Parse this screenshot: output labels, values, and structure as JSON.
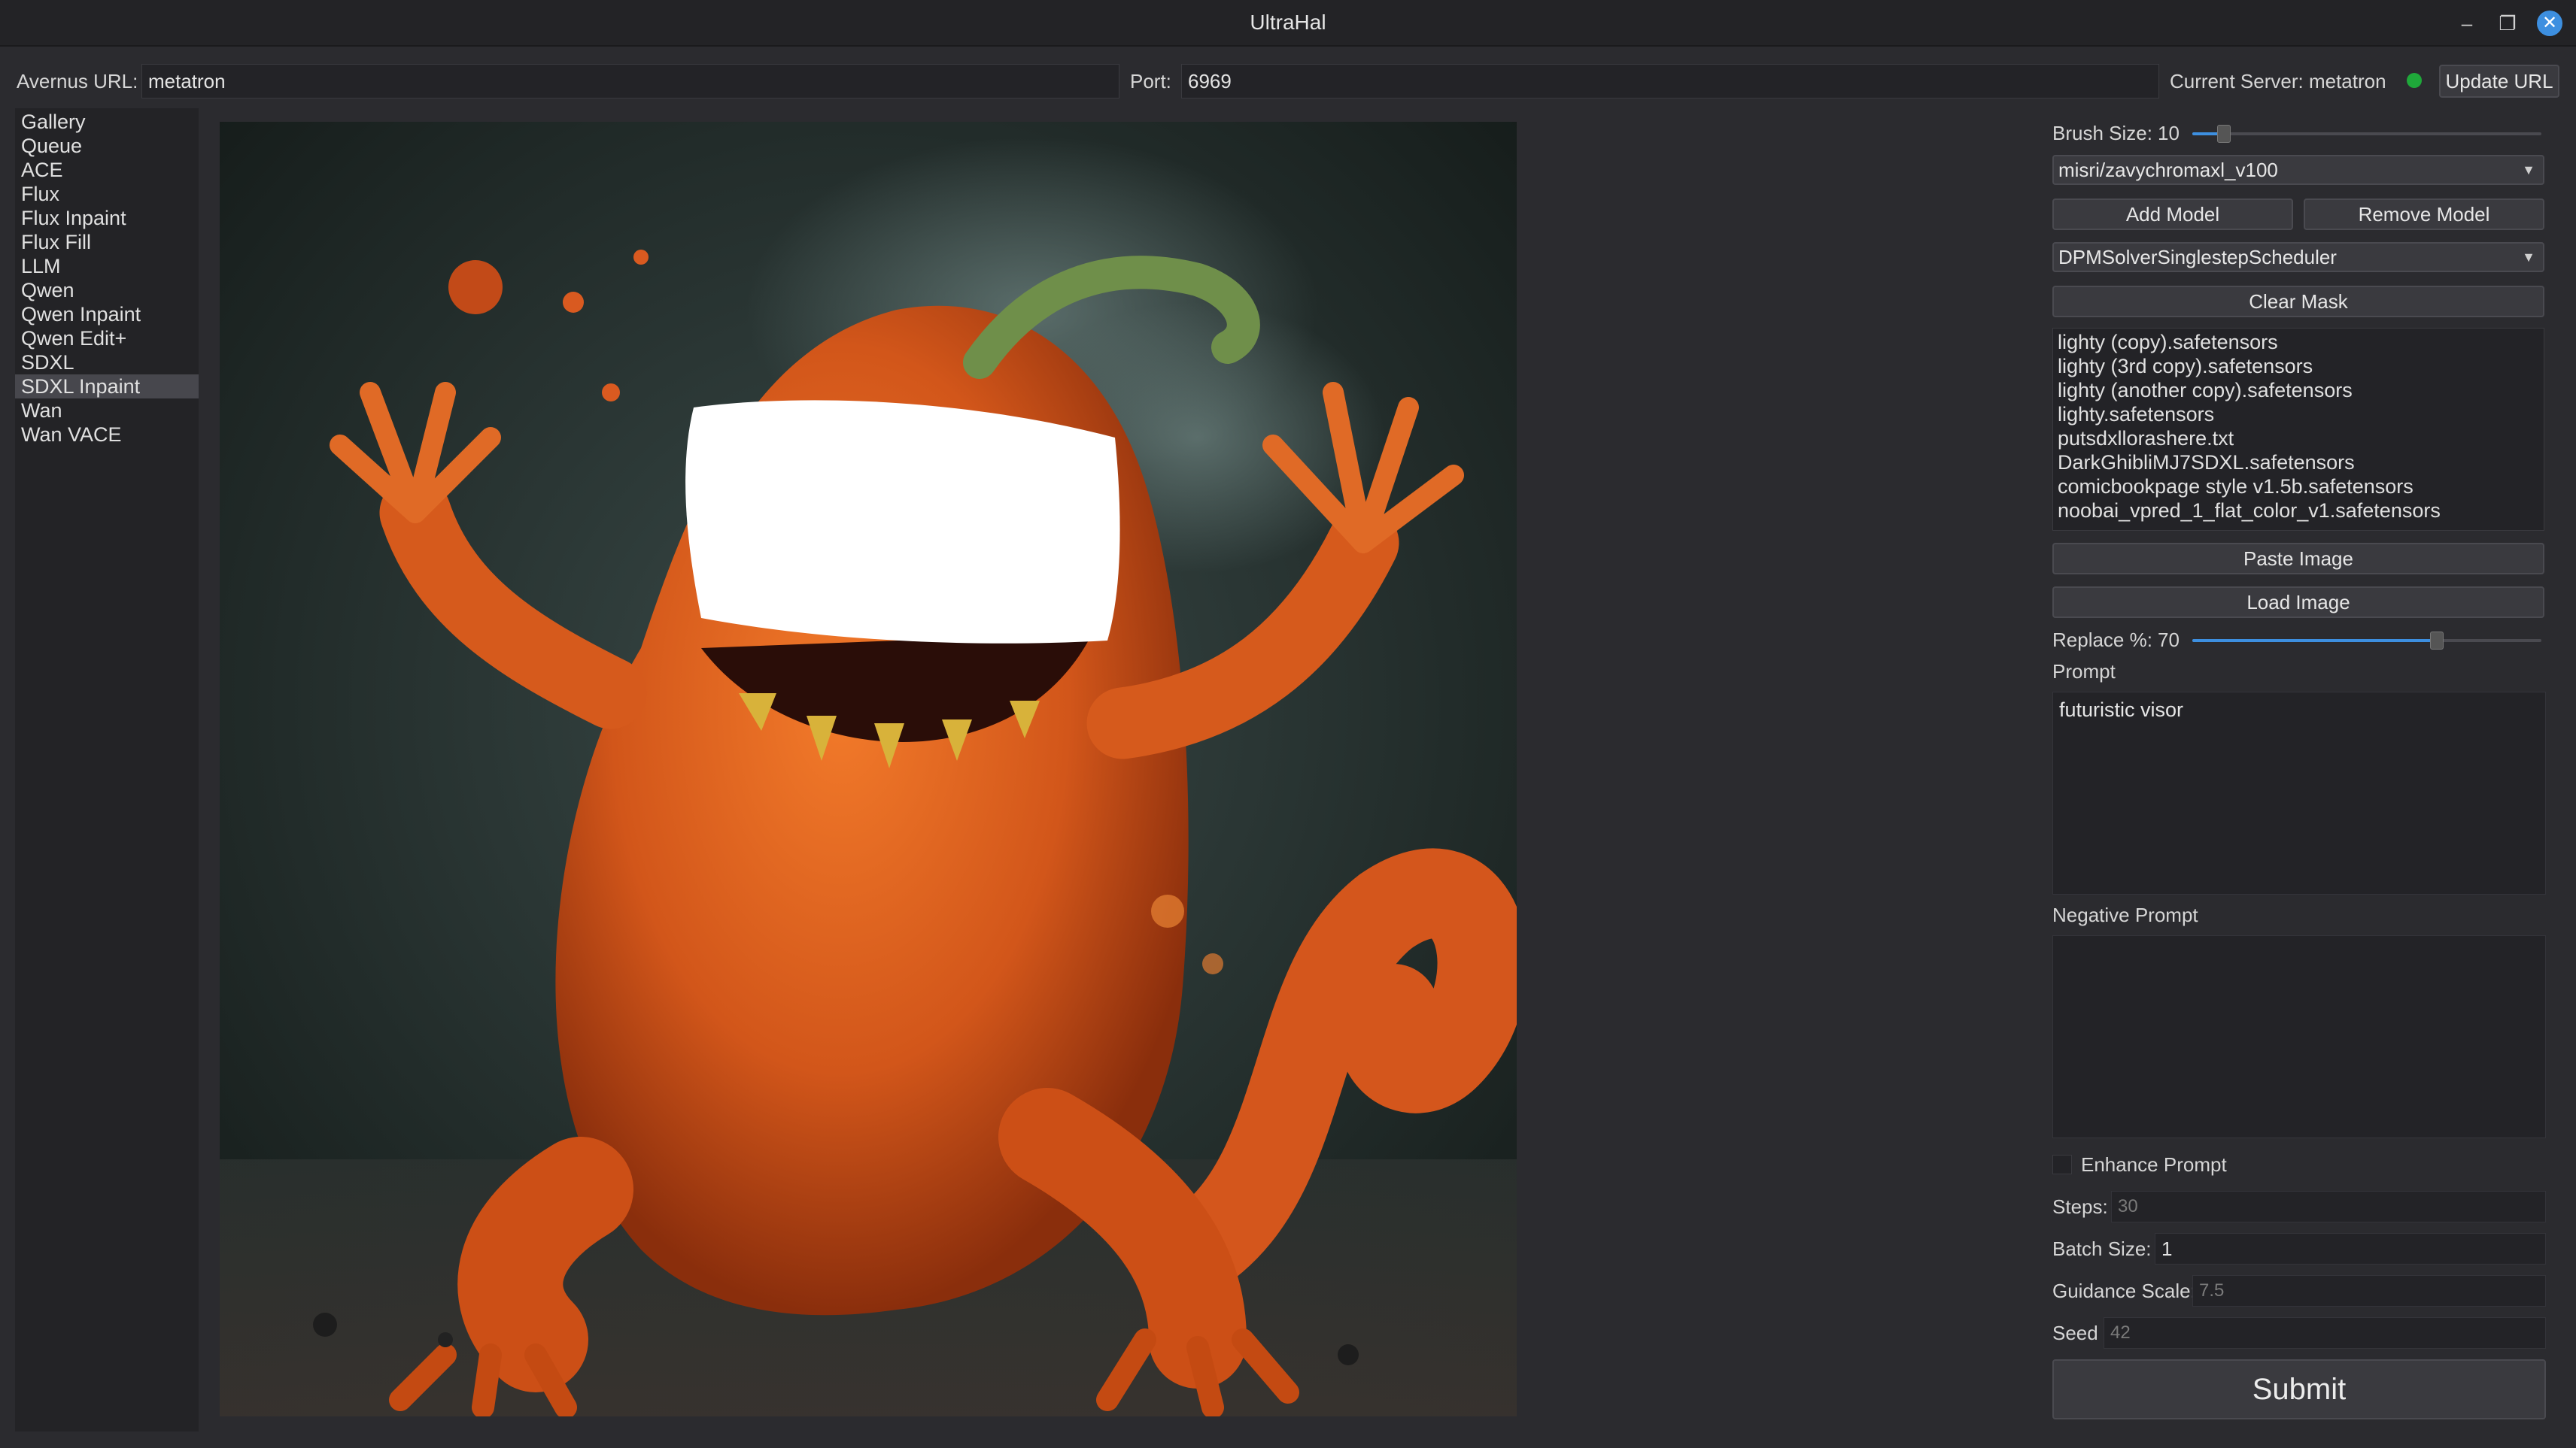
{
  "window": {
    "title": "UltraHal",
    "minimize_glyph": "–",
    "maximize_glyph": "❐",
    "close_glyph": "✕"
  },
  "urlbar": {
    "avernus_label": "Avernus URL:",
    "avernus_value": "metatron",
    "port_label": "Port:",
    "port_value": "6969",
    "current_server": "Current Server: metatron",
    "server_status_color": "#1fa83a",
    "update_button": "Update URL"
  },
  "sidebar": {
    "items": [
      {
        "label": "Gallery"
      },
      {
        "label": "Queue"
      },
      {
        "label": "ACE"
      },
      {
        "label": "Flux"
      },
      {
        "label": "Flux Inpaint"
      },
      {
        "label": "Flux Fill"
      },
      {
        "label": "LLM"
      },
      {
        "label": "Qwen"
      },
      {
        "label": "Qwen Inpaint"
      },
      {
        "label": "Qwen Edit+"
      },
      {
        "label": "SDXL"
      },
      {
        "label": "SDXL Inpaint"
      },
      {
        "label": "Wan"
      },
      {
        "label": "Wan VACE"
      }
    ],
    "active_item": "SDXL Inpaint"
  },
  "controls": {
    "brush_size_label": "Brush Size:",
    "brush_size_value": "10",
    "brush_size_fraction": 0.09,
    "model_selected": "misri/zavychromaxl_v100",
    "add_model": "Add Model",
    "remove_model": "Remove Model",
    "scheduler_selected": "DPMSolverSinglestepScheduler",
    "clear_mask": "Clear Mask",
    "lora_files": [
      "lighty (copy).safetensors",
      "lighty (3rd copy).safetensors",
      "lighty (another copy).safetensors",
      "lighty.safetensors",
      "putsdxllorashere.txt",
      "DarkGhibliMJ7SDXL.safetensors",
      "comicbookpage style v1.5b.safetensors",
      "noobai_vpred_1_flat_color_v1.safetensors"
    ],
    "paste_image": "Paste Image",
    "load_image": "Load Image",
    "replace_label": "Replace %:",
    "replace_value": "70",
    "replace_fraction": 0.7,
    "prompt_label": "Prompt",
    "prompt_value": "futuristic visor",
    "negative_prompt_label": "Negative Prompt",
    "negative_prompt_value": "",
    "enhance_prompt_label": "Enhance Prompt",
    "enhance_prompt_checked": false,
    "steps_label": "Steps:",
    "steps_placeholder": "30",
    "batch_size_label": "Batch Size:",
    "batch_size_value": "1",
    "guidance_label": "Guidance Scale:",
    "guidance_placeholder": "7.5",
    "seed_label": "Seed",
    "seed_placeholder": "42",
    "submit": "Submit",
    "accent_color": "#3d8fe0"
  }
}
